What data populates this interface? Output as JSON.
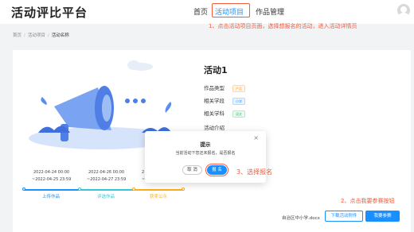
{
  "header": {
    "brand": "活动评比平台",
    "nav": [
      "首页",
      "活动项目",
      "作品管理"
    ]
  },
  "annotations": {
    "step1": "1、点击活动项目页面，选择想报名的活动，进入活动详情页",
    "step2": "2、点击我要参赛按钮",
    "step3": "3、选择报名"
  },
  "breadcrumb": [
    "首页",
    "活动项目",
    "活动名称"
  ],
  "activity": {
    "title": "活动1",
    "fields": [
      {
        "label": "作品类型",
        "tag": "产品"
      },
      {
        "label": "相关学段",
        "tag": "小学"
      },
      {
        "label": "相关学科",
        "tag": "语文"
      }
    ],
    "intro_label": "活动介绍"
  },
  "timeline": [
    {
      "start": "2022-04-24 00:00",
      "end": "~2022-04-25 23:59",
      "label": "上传作品",
      "color": "#1890ff"
    },
    {
      "start": "2022-04-26 00:00",
      "end": "~2022-04-27 23:59",
      "label": "评选作品",
      "color": "#36c6d3"
    },
    {
      "start": "2",
      "end": "~",
      "label": "获奖公示",
      "color": "#faad14"
    }
  ],
  "modal": {
    "title": "提示",
    "message": "当前活动下您还未报名，是否报名",
    "cancel": "取 消",
    "confirm": "报 名"
  },
  "footer": {
    "file": "自治区中小学.docx",
    "download": "下载活动附件",
    "join": "我要参赛"
  },
  "colors": {
    "primary": "#1890ff",
    "annotation": "#f25a3c"
  }
}
